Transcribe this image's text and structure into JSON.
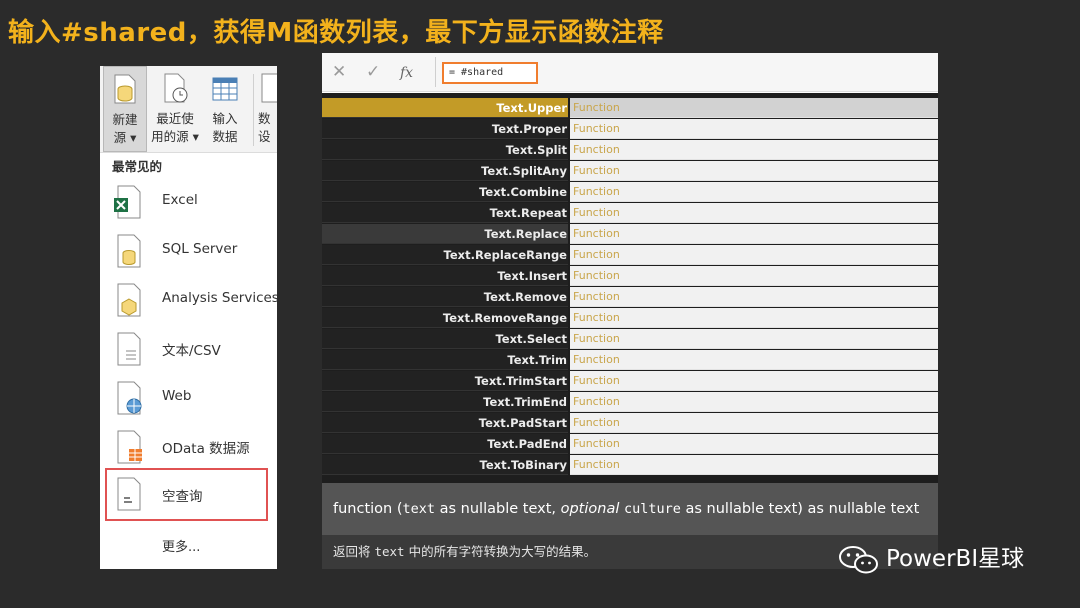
{
  "slide": {
    "title": "输入#shared，获得M函数列表，最下方显示函数注释"
  },
  "ribbon": {
    "buttons": [
      {
        "label": "新建\n源 ▾",
        "icon": "database-icon"
      },
      {
        "label": "最近使\n用的源 ▾",
        "icon": "recent-sources-icon"
      },
      {
        "label": "输入\n数据",
        "icon": "table-grid-icon"
      },
      {
        "label": "数\n设",
        "icon": "document-icon"
      }
    ]
  },
  "source_menu": {
    "section_title": "最常见的",
    "items": [
      {
        "label": "Excel",
        "icon": "excel-icon"
      },
      {
        "label": "SQL Server",
        "icon": "sql-server-icon"
      },
      {
        "label": "Analysis Services",
        "icon": "analysis-services-icon"
      },
      {
        "label": "文本/CSV",
        "icon": "text-csv-icon"
      },
      {
        "label": "Web",
        "icon": "web-icon"
      },
      {
        "label": "OData 数据源",
        "icon": "odata-icon"
      },
      {
        "label": "空查询",
        "icon": "blank-query-icon"
      }
    ],
    "more": "更多..."
  },
  "formula_bar": {
    "cancel_icon": "✕",
    "confirm_icon": "✓",
    "fx_label": "fx",
    "value": "= #shared"
  },
  "autocomplete": {
    "items": [
      {
        "name": "Text.Upper",
        "type": "Function"
      },
      {
        "name": "Text.Proper",
        "type": "Function"
      },
      {
        "name": "Text.Split",
        "type": "Function"
      },
      {
        "name": "Text.SplitAny",
        "type": "Function"
      },
      {
        "name": "Text.Combine",
        "type": "Function"
      },
      {
        "name": "Text.Repeat",
        "type": "Function"
      },
      {
        "name": "Text.Replace",
        "type": "Function"
      },
      {
        "name": "Text.ReplaceRange",
        "type": "Function"
      },
      {
        "name": "Text.Insert",
        "type": "Function"
      },
      {
        "name": "Text.Remove",
        "type": "Function"
      },
      {
        "name": "Text.RemoveRange",
        "type": "Function"
      },
      {
        "name": "Text.Select",
        "type": "Function"
      },
      {
        "name": "Text.Trim",
        "type": "Function"
      },
      {
        "name": "Text.TrimStart",
        "type": "Function"
      },
      {
        "name": "Text.TrimEnd",
        "type": "Function"
      },
      {
        "name": "Text.PadStart",
        "type": "Function"
      },
      {
        "name": "Text.PadEnd",
        "type": "Function"
      },
      {
        "name": "Text.ToBinary",
        "type": "Function"
      }
    ]
  },
  "signature": {
    "p1": "function (",
    "text_param": "text",
    "p2": " as nullable text, ",
    "optional_kw": "optional",
    "p3": " ",
    "culture_param": "culture",
    "p4": " as nullable text) as nullable text"
  },
  "description": {
    "p1": "返回将 ",
    "code": "text",
    "p2": " 中的所有字符转换为大写的结果。"
  },
  "brand": {
    "name": "PowerBI星球",
    "icon": "wechat-icon"
  },
  "colors": {
    "title": "#f3b21c",
    "selected_row": "#c39b27",
    "formula_border": "#f07d2e",
    "highlight_border": "#e05252",
    "function_type_text": "#c9a64c"
  }
}
